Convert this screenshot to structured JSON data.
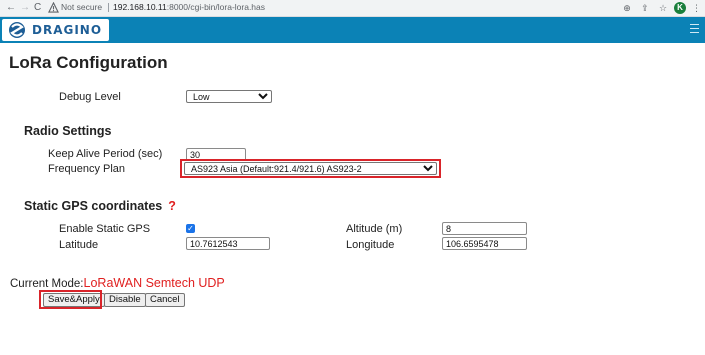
{
  "browser": {
    "security_label": "Not secure",
    "url_host": "192.168.10.11",
    "url_path": ":8000/cgi-bin/lora-lora.has",
    "profile_initial": "K"
  },
  "header": {
    "logo_text": "DRAGINO",
    "brand_color": "#0b82b6"
  },
  "page": {
    "title": "LoRa Configuration"
  },
  "debug": {
    "label": "Debug Level",
    "value": "Low"
  },
  "radio": {
    "heading": "Radio Settings",
    "keep_alive_label": "Keep Alive Period (sec)",
    "keep_alive_value": "30",
    "freq_label": "Frequency Plan",
    "freq_value": "AS923 Asia (Default:921.4/921.6) AS923-2"
  },
  "gps": {
    "heading": "Static GPS coordinates",
    "help": "?",
    "enable_label": "Enable Static GPS",
    "enabled": true,
    "latitude_label": "Latitude",
    "latitude_value": "10.7612543",
    "altitude_label": "Altitude (m)",
    "altitude_value": "8",
    "longitude_label": "Longitude",
    "longitude_value": "106.6595478"
  },
  "mode": {
    "label": "Current Mode:",
    "value": "LoRaWAN Semtech UDP"
  },
  "actions": {
    "save": "Save&Apply",
    "disable": "Disable",
    "cancel": "Cancel"
  },
  "colors": {
    "highlight": "#d9242a",
    "accent_red": "#e02020",
    "checkbox": "#1a73e8"
  }
}
